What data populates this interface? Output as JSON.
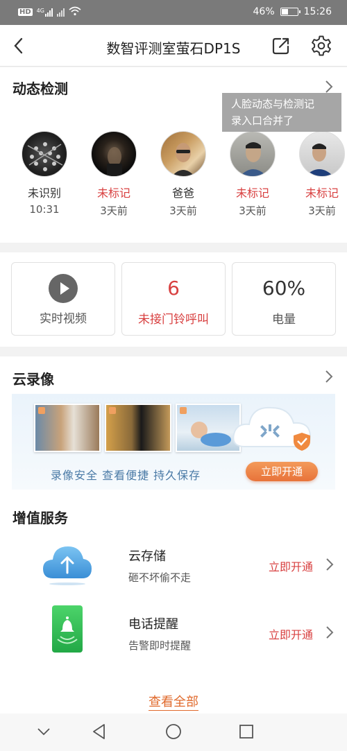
{
  "status_bar": {
    "left_icons": [
      "hd-icon",
      "signal-4g-icon",
      "signal-icon",
      "wifi-icon"
    ],
    "hd": "HD",
    "net": "4G",
    "battery": "46%",
    "battery_level": 0.46,
    "time": "15:26"
  },
  "nav": {
    "title": "数智评测室萤石DP1S"
  },
  "motion": {
    "title": "动态检测",
    "tooltip": [
      "人脸动态与检测记",
      "录入口合并了"
    ],
    "faces": [
      {
        "name": "未识别",
        "time": "10:31",
        "highlight": false
      },
      {
        "name": "未标记",
        "time": "3天前",
        "highlight": true
      },
      {
        "name": "爸爸",
        "time": "3天前",
        "highlight": false
      },
      {
        "name": "未标记",
        "time": "3天前",
        "highlight": true
      },
      {
        "name": "未标记",
        "time": "3天前",
        "highlight": true
      }
    ]
  },
  "quick": {
    "live": {
      "label": "实时视频"
    },
    "missed": {
      "value": "6",
      "label": "未接门铃呼叫"
    },
    "battery": {
      "value": "60%",
      "label": "电量"
    }
  },
  "cloud": {
    "title": "云录像",
    "banner_text": "录像安全  查看便捷  持久保存",
    "open_label": "立即开通"
  },
  "services": {
    "title": "增值服务",
    "items": [
      {
        "title": "云存储",
        "subtitle": "砸不坏偷不走",
        "action": "立即开通"
      },
      {
        "title": "电话提醒",
        "subtitle": "告警即时提醒",
        "action": "立即开通"
      }
    ],
    "see_all": "查看全部"
  },
  "colors": {
    "accent_red": "#d84040",
    "accent_orange": "#e8733a",
    "link_blue": "#4a7aa6"
  }
}
